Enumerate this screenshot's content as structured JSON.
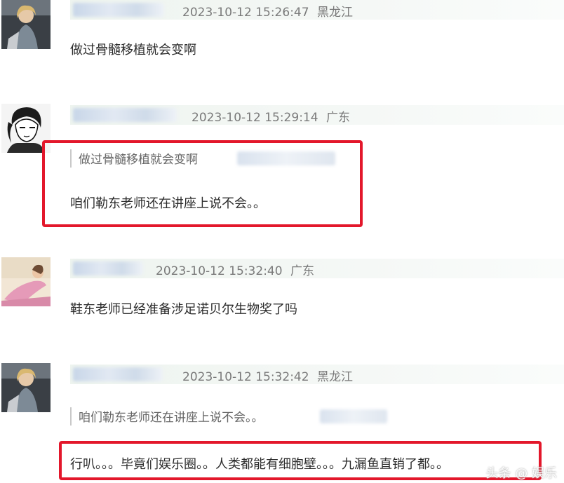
{
  "comments": [
    {
      "avatar": "avatar-woman-blonde-icon",
      "timestamp": "2023-10-12 15:26:47",
      "location": "黑龙江",
      "text": "做过骨髓移植就会变啊"
    },
    {
      "avatar": "avatar-manga-girl-icon",
      "timestamp": "2023-10-12 15:29:14",
      "location": "广东",
      "quote": "做过骨髓移植就会变啊",
      "text": "咱们勒东老师还在讲座上说不会。。"
    },
    {
      "avatar": "avatar-painting-woman-icon",
      "timestamp": "2023-10-12 15:32:40",
      "location": "广东",
      "text": "鞋东老师已经准备涉足诺贝尔生物奖了吗"
    },
    {
      "avatar": "avatar-woman-blonde-icon",
      "timestamp": "2023-10-12 15:32:42",
      "location": "黑龙江",
      "quote": "咱们勒东老师还在讲座上说不会。。",
      "text": "行叭。。。毕竟们娱乐圈。。人类都能有细胞壁。。。九漏鱼直销了都。。"
    }
  ],
  "watermark": "头条 @ 娱乐",
  "colors": {
    "highlight": "#e3172b",
    "meta_text": "#7a7a7a",
    "meta_bar": "#eef4ef"
  }
}
